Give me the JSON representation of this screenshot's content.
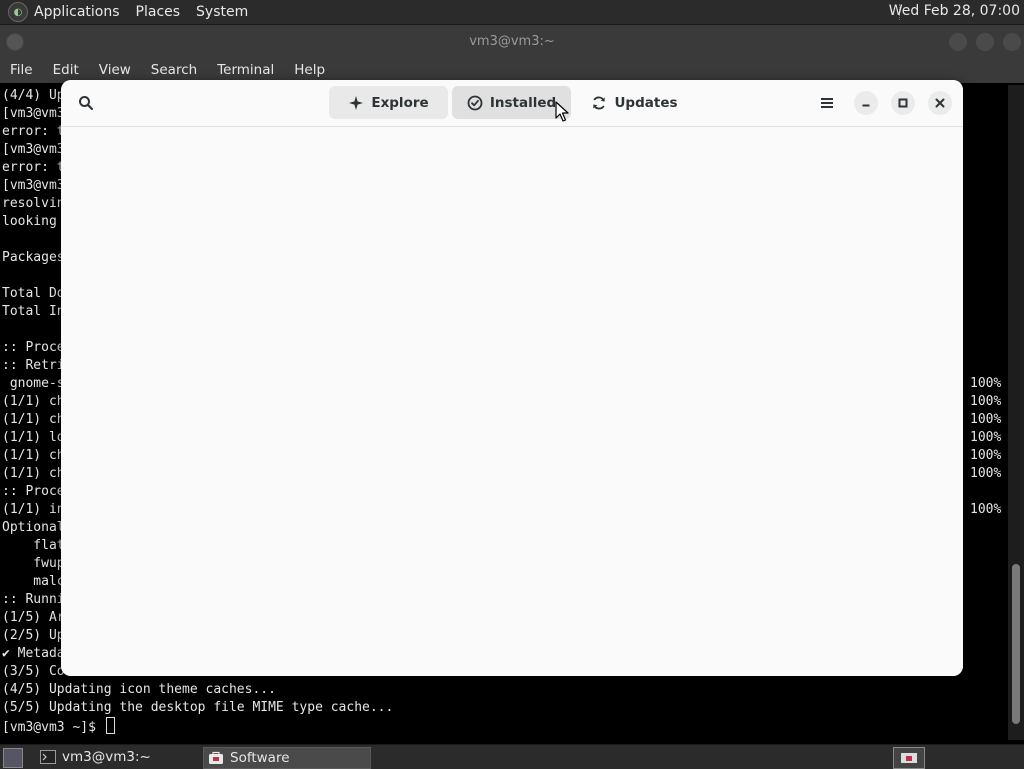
{
  "top_panel": {
    "menus": [
      "Applications",
      "Places",
      "System"
    ],
    "clock": "Wed Feb 28, 07:00"
  },
  "terminal": {
    "title": "vm3@vm3:~",
    "menu": [
      "File",
      "Edit",
      "View",
      "Search",
      "Terminal",
      "Help"
    ],
    "lines": [
      "(4/4) Up",
      "[vm3@vm3",
      "error: t",
      "[vm3@vm3",
      "error: t",
      "[vm3@vm3",
      "resolvin",
      "looking ",
      "",
      "Packages",
      "",
      "Total Do",
      "Total In",
      "",
      ":: Proce",
      ":: Retri",
      " gnome-s",
      "(1/1) ch",
      "(1/1) ch",
      "(1/1) lo",
      "(1/1) ch",
      "(1/1) ch",
      ":: Proce",
      "(1/1) in",
      "Optional",
      "    flat",
      "    fwup",
      "    malc",
      ":: Runni",
      "(1/5) Ar",
      "(2/5) Up",
      "✔ Metada",
      "(3/5) Co",
      "(4/5) Updating icon theme caches...",
      "(5/5) Updating the desktop file MIME type cache...",
      "[vm3@vm3 ~]$ "
    ],
    "percent_lines": [
      {
        "row": 16,
        "text": "100%"
      },
      {
        "row": 17,
        "text": "100%"
      },
      {
        "row": 18,
        "text": "100%"
      },
      {
        "row": 19,
        "text": "100%"
      },
      {
        "row": 20,
        "text": "100%"
      },
      {
        "row": 21,
        "text": "100%"
      },
      {
        "row": 23,
        "text": "100%"
      }
    ]
  },
  "software": {
    "tabs": {
      "explore": "Explore",
      "installed": "Installed",
      "updates": "Updates"
    },
    "active_tab": "installed"
  },
  "taskbar": {
    "terminal_task": "vm3@vm3:~",
    "software_task": "Software"
  },
  "colors": {
    "panel": "#2b2b2b",
    "terminal_bg": "#000000",
    "software_bg": "#fafafa",
    "accent_text": "#2e3436"
  }
}
